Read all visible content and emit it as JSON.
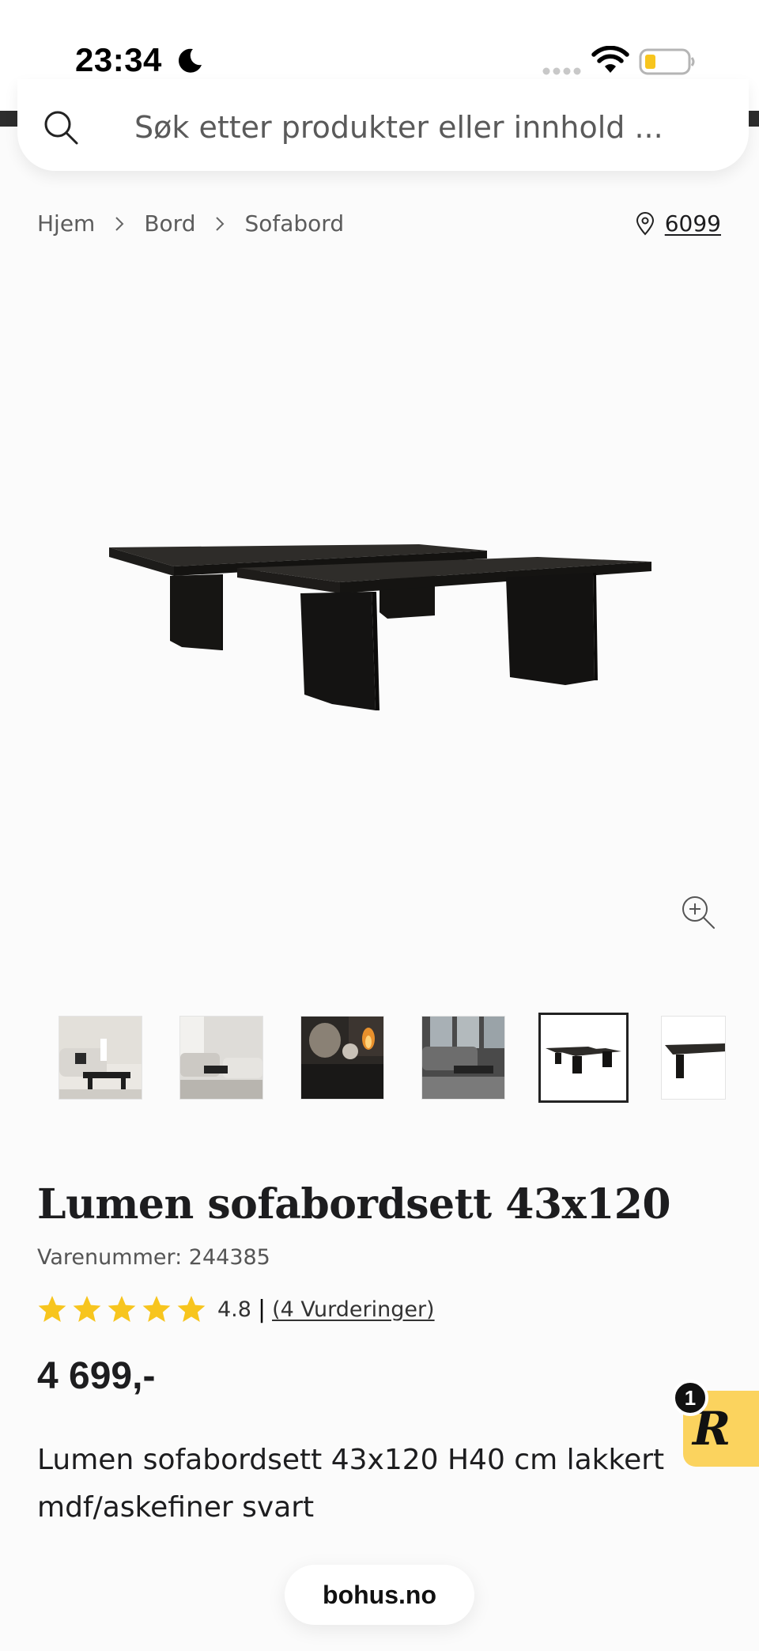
{
  "status_bar": {
    "time": "23:34",
    "icons": [
      "moon-icon",
      "cellular-signal-icon",
      "wifi-icon",
      "battery-low-icon"
    ]
  },
  "search": {
    "placeholder": "Søk etter produkter eller innhold ..."
  },
  "breadcrumb": {
    "items": [
      "Hjem",
      "Bord",
      "Sofabord"
    ]
  },
  "location": {
    "postcode": "6099"
  },
  "gallery": {
    "thumbnail_count": 6,
    "active_index": 4
  },
  "product": {
    "title": "Lumen sofabordsett 43x120",
    "sku": "Varenummer: 244385",
    "rating_value": "4.8",
    "rating_max": 5,
    "rating_sep": "|",
    "reviews_link": "(4 Vurderinger)",
    "price": "4 699,-",
    "description": "Lumen sofabordsett 43x120 H40 cm lakkert mdf/askefiner svart"
  },
  "widget": {
    "letter": "R",
    "badge_count": "1"
  },
  "browser": {
    "url": "bohus.no"
  },
  "colors": {
    "star": "#f7c51e",
    "product_bg": "#f4f3f2",
    "widget_bg": "#fbd35e"
  }
}
